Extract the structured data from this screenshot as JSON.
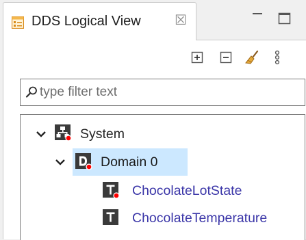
{
  "tab": {
    "title": "DDS Logical View",
    "icon": "dds-view-icon",
    "close_glyph": "☒"
  },
  "window_controls": [
    "minimize-icon",
    "maximize-icon"
  ],
  "toolbar": {
    "buttons": [
      "expand-all-icon",
      "collapse-all-icon",
      "clear-broom-icon",
      "view-menu-icon"
    ]
  },
  "filter": {
    "value": "",
    "placeholder": "type filter text",
    "icon": "search-icon"
  },
  "tree": {
    "system": {
      "label": "System",
      "icon": "system-icon",
      "expanded": true
    },
    "domain": {
      "label": "Domain 0",
      "icon": "domain-icon",
      "expanded": true,
      "selected": true
    },
    "topics": [
      {
        "label": "ChocolateLotState",
        "icon": "topic-icon",
        "badge": true
      },
      {
        "label": "ChocolateTemperature",
        "icon": "topic-icon",
        "badge": false
      }
    ]
  },
  "colors": {
    "selection": "#cce8ff",
    "badge": "#ff0000",
    "icon_dark": "#3a3a3a",
    "topic_text": "#3b36a8",
    "label_text": "#232323"
  }
}
